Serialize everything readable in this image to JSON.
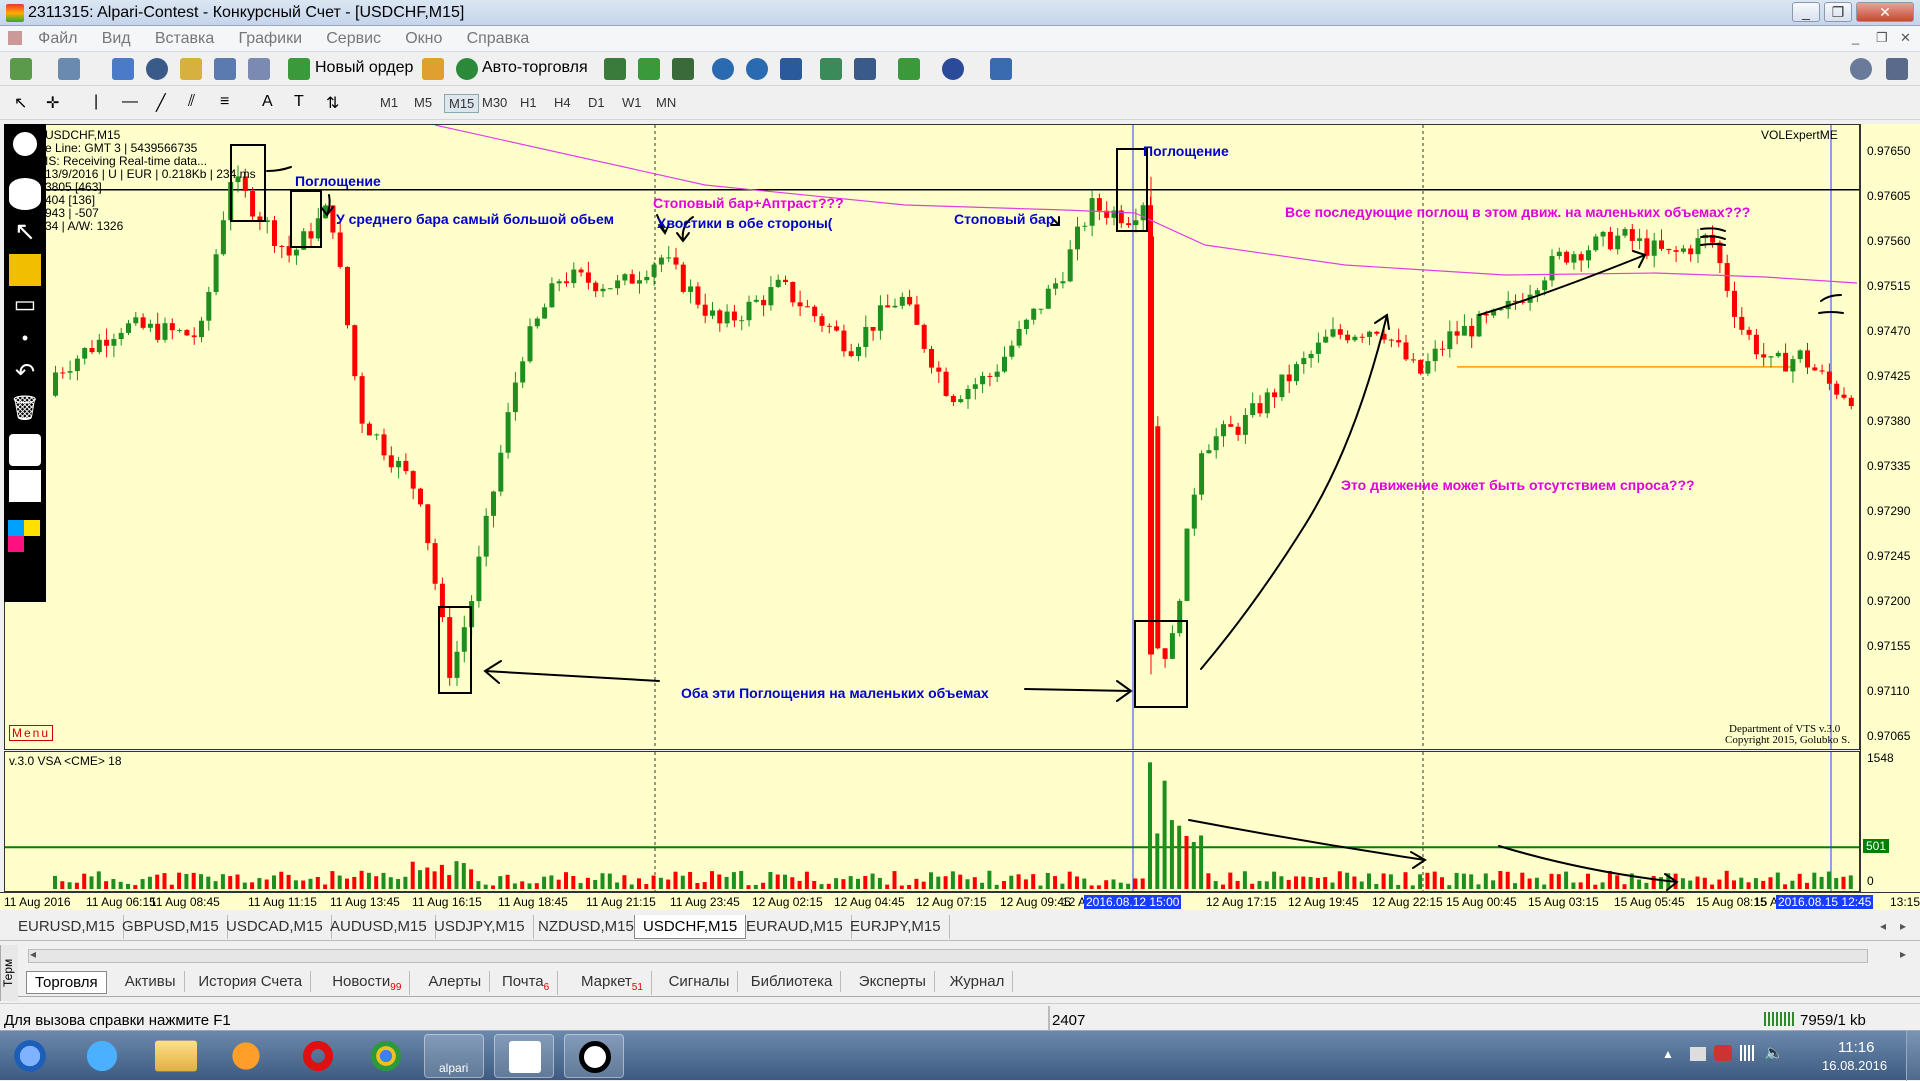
{
  "window": {
    "title": "2311315: Alpari-Contest - Конкурсный Счет - [USDCHF,M15]"
  },
  "menu": [
    "Файл",
    "Вид",
    "Вставка",
    "Графики",
    "Сервис",
    "Окно",
    "Справка"
  ],
  "toolbar": {
    "new_order": "Новый ордер",
    "auto_trading": "Авто-торговля"
  },
  "timeframes": [
    "M1",
    "M5",
    "M15",
    "M30",
    "H1",
    "H4",
    "D1",
    "W1",
    "MN"
  ],
  "active_timeframe": "M15",
  "chart_info": {
    "symbol": "USDCHF,M15",
    "line2": "e Line: GMT 3 | 5439566735",
    "line3": "IS:  Receiving Real-time data...",
    "line4": "13/9/2016 | U | EUR | 0.218Kb | 234 ms",
    "line5": "3805  [463]",
    "line6": "404  [136]",
    "line7": "943 | -507",
    "line8": "34 | A/W: 1326",
    "indicator_name": "VOLExpertME",
    "menu_label": "Menu",
    "copyright1": "Department of VTS  v.3.0",
    "copyright2": "Copyright 2015, Golubko S."
  },
  "volume_panel": {
    "title": "v.3.0 VSA <CME> 18",
    "max_label": "1548",
    "level_label": "501",
    "zero_label": "0"
  },
  "annotations": {
    "a1": "Поглощение",
    "a2": "У среднего бара самый большой обьем",
    "a3": "Стоповый бар+Аптраст???",
    "a4": "Хвостики в обе стороны(",
    "a5": "Стоповый бар",
    "a6": "Поглощение",
    "a7": "Все последующие поглощ в этом движ. на маленьких объемах???",
    "a8": "Это движение может быть отсутствием спроса???",
    "a9": "Оба эти Поглощения на маленьких объемах"
  },
  "price_scale": [
    "0.97650",
    "0.97605",
    "0.97560",
    "0.97515",
    "0.97470",
    "0.97425",
    "0.97380",
    "0.97335",
    "0.97290",
    "0.97245",
    "0.97200",
    "0.97155",
    "0.97110",
    "0.97065"
  ],
  "time_labels": [
    "11 Aug 2016",
    "11 Aug 06:15",
    "11 Aug 08:45",
    "11 Aug 11:15",
    "11 Aug 13:45",
    "11 Aug 16:15",
    "11 Aug 18:45",
    "11 Aug 21:15",
    "11 Aug 23:45",
    "12 Aug 02:15",
    "12 Aug 04:45",
    "12 Aug 07:15",
    "12 Aug 09:45",
    "12 Aug",
    "2016.08.12 15:00",
    "12 Aug 17:15",
    "12 Aug 19:45",
    "12 Aug 22:15",
    "15 Aug 00:45",
    "15 Aug 03:15",
    "15 Aug 05:45",
    "15 Aug 08:15",
    "15 Aug",
    "2016.08.15 12:45",
    "13:15"
  ],
  "symbol_tabs": [
    "EURUSD,M15",
    "GBPUSD,M15",
    "USDCAD,M15",
    "AUDUSD,M15",
    "USDJPY,M15",
    "NZDUSD,M15",
    "USDCHF,M15",
    "EURAUD,M15",
    "EURJPY,M15"
  ],
  "active_symbol_tab": "USDCHF,M15",
  "terminal_label": "Терм",
  "terminal_tabs": [
    {
      "label": "Торговля",
      "badge": ""
    },
    {
      "label": "Активы",
      "badge": ""
    },
    {
      "label": "История Счета",
      "badge": ""
    },
    {
      "label": "Новости",
      "badge": "99"
    },
    {
      "label": "Алерты",
      "badge": ""
    },
    {
      "label": "Почта",
      "badge": "6"
    },
    {
      "label": "Маркет",
      "badge": "51"
    },
    {
      "label": "Сигналы",
      "badge": ""
    },
    {
      "label": "Библиотека",
      "badge": ""
    },
    {
      "label": "Эксперты",
      "badge": ""
    },
    {
      "label": "Журнал",
      "badge": ""
    }
  ],
  "status": {
    "help": "Для вызова справки нажмите F1",
    "bars": "2407",
    "traffic": "7959/1 kb"
  },
  "clock": {
    "time": "11:16",
    "date": "16.08.2016"
  },
  "taskbar_apps": [
    "start",
    "internet-explorer",
    "explorer",
    "media-player",
    "opera",
    "chrome",
    "alpari",
    "fxpro",
    "vsa-app"
  ],
  "taskbar_labels": {
    "alpari": "alpari"
  },
  "colors": {
    "chart_bg": "#ffffcc",
    "bull": "#1e8f1e",
    "bear": "#ff0000",
    "ma": "#e040e0",
    "level": "#ff9900",
    "volume_level": "#008000"
  }
}
